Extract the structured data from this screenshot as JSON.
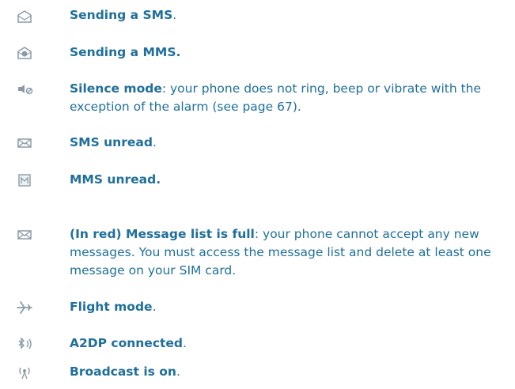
{
  "entries": [
    {
      "icon": "sending-sms-icon",
      "bold": "Sending a SMS",
      "rest": "."
    },
    {
      "icon": "sending-mms-icon",
      "bold": "Sending a MMS.",
      "rest": ""
    },
    {
      "icon": "silence-mode-icon",
      "bold": "Silence mode",
      "rest": ": your phone does not ring, beep or vibrate with the exception of the alarm (see page 67)."
    },
    {
      "icon": "sms-unread-icon",
      "bold": "SMS unread",
      "rest": "."
    },
    {
      "icon": "mms-unread-icon",
      "bold": "MMS unread.",
      "rest": ""
    },
    {
      "icon": "message-list-full-icon",
      "bold": "(In red) Message list is full",
      "rest": ": your phone cannot accept any new messages. You must access the message list and delete at least one message on your SIM card."
    },
    {
      "icon": "flight-mode-icon",
      "bold": "Flight mode",
      "rest": "."
    },
    {
      "icon": "a2dp-connected-icon",
      "bold": "A2DP connected",
      "rest": "."
    },
    {
      "icon": "broadcast-icon",
      "bold": "Broadcast is on",
      "rest": "."
    }
  ]
}
